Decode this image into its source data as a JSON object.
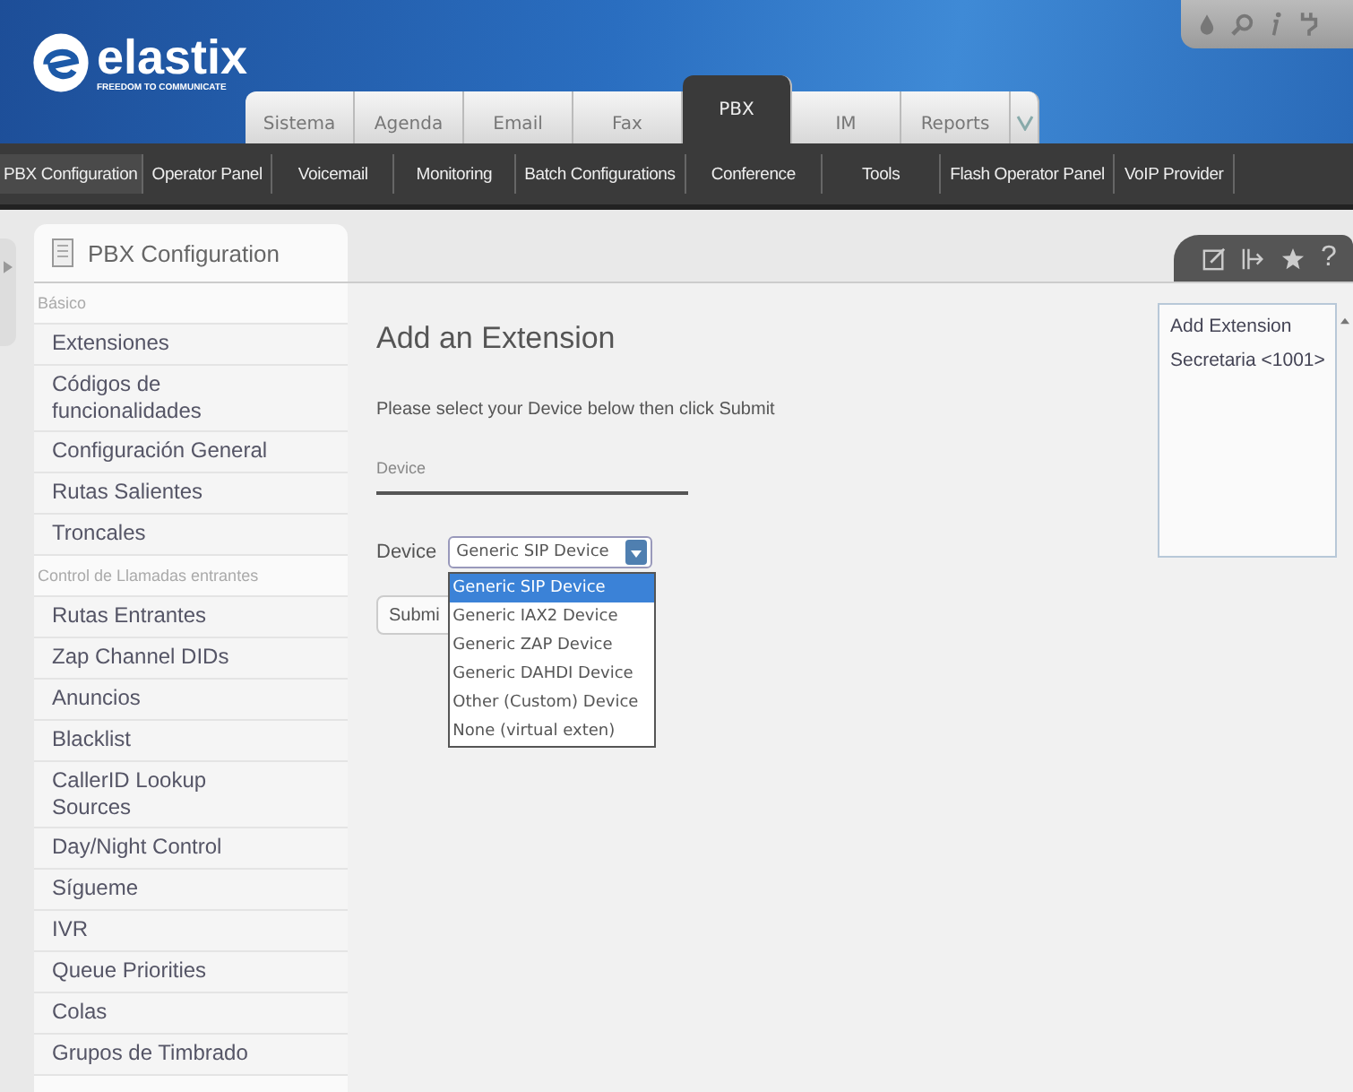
{
  "logo": {
    "name": "elastix",
    "tagline": "FREEDOM TO COMMUNICATE"
  },
  "main_tabs": [
    {
      "label": "Sistema",
      "selected": false
    },
    {
      "label": "Agenda",
      "selected": false
    },
    {
      "label": "Email",
      "selected": false
    },
    {
      "label": "Fax",
      "selected": false
    },
    {
      "label": "PBX",
      "selected": true
    },
    {
      "label": "IM",
      "selected": false
    },
    {
      "label": "Reports",
      "selected": false
    }
  ],
  "submenu": [
    {
      "label": "PBX Configuration",
      "selected": true
    },
    {
      "label": "Operator Panel",
      "selected": false
    },
    {
      "label": "Voicemail",
      "selected": false
    },
    {
      "label": "Monitoring",
      "selected": false
    },
    {
      "label": "Batch Configurations",
      "selected": false
    },
    {
      "label": "Conference",
      "selected": false
    },
    {
      "label": "Tools",
      "selected": false
    },
    {
      "label": "Flash Operator Panel",
      "selected": false
    },
    {
      "label": "VoIP Provider",
      "selected": false
    }
  ],
  "page_tab": {
    "title": "PBX Configuration"
  },
  "page_tab_actions": {
    "help": "?"
  },
  "sidebar": {
    "items": [
      {
        "kind": "header",
        "label": "Básico"
      },
      {
        "kind": "link",
        "label": "Extensiones"
      },
      {
        "kind": "link",
        "label": "Códigos de funcionalidades"
      },
      {
        "kind": "link",
        "label": "Configuración General"
      },
      {
        "kind": "link",
        "label": "Rutas Salientes"
      },
      {
        "kind": "link",
        "label": "Troncales"
      },
      {
        "kind": "header",
        "label": "Control de Llamadas entrantes"
      },
      {
        "kind": "link",
        "label": "Rutas Entrantes"
      },
      {
        "kind": "link",
        "label": "Zap Channel DIDs"
      },
      {
        "kind": "link",
        "label": "Anuncios"
      },
      {
        "kind": "link",
        "label": "Blacklist"
      },
      {
        "kind": "link",
        "label": "CallerID Lookup Sources"
      },
      {
        "kind": "link",
        "label": "Day/Night Control"
      },
      {
        "kind": "link",
        "label": "Sígueme"
      },
      {
        "kind": "link",
        "label": "IVR"
      },
      {
        "kind": "link",
        "label": "Queue Priorities"
      },
      {
        "kind": "link",
        "label": "Colas"
      },
      {
        "kind": "link",
        "label": "Grupos de Timbrado"
      }
    ]
  },
  "form": {
    "title": "Add an Extension",
    "instructions": "Please select your Device below then click Submit",
    "section": "Device",
    "device_label": "Device",
    "device_value": "Generic SIP Device",
    "submit": "Submi",
    "options": [
      {
        "label": "Generic SIP Device",
        "selected": true
      },
      {
        "label": "Generic IAX2 Device",
        "selected": false
      },
      {
        "label": "Generic ZAP Device",
        "selected": false
      },
      {
        "label": "Generic DAHDI Device",
        "selected": false
      },
      {
        "label": "Other (Custom) Device",
        "selected": false
      },
      {
        "label": "None (virtual exten)",
        "selected": false
      }
    ]
  },
  "extension_list": [
    "Add Extension",
    "Secretaria <1001>"
  ]
}
